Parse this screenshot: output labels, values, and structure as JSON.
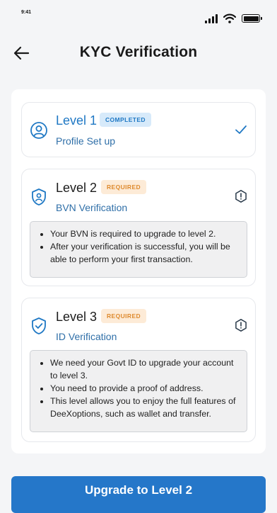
{
  "status_bar": {
    "time": "9:41"
  },
  "header": {
    "title": "KYC Verification"
  },
  "levels": [
    {
      "title": "Level 1",
      "badge": "COMPLETED",
      "subtitle": "Profile Set up",
      "status": "completed",
      "icon": "user-circle-icon",
      "status_icon": "check-icon"
    },
    {
      "title": "Level 2",
      "badge": "REQUIRED",
      "subtitle": "BVN Verification",
      "status": "required",
      "icon": "shield-user-icon",
      "status_icon": "info-alert-icon",
      "notes": [
        "Your BVN is required to upgrade to level 2.",
        "After your verification is successful, you will be able to perform your first transaction."
      ]
    },
    {
      "title": "Level 3",
      "badge": "REQUIRED",
      "subtitle": "ID Verification",
      "status": "required",
      "icon": "shield-check-icon",
      "status_icon": "info-alert-icon",
      "notes": [
        "We need your Govt ID to upgrade your account to level 3.",
        "You need to provide a proof of address.",
        "This level allows you to enjoy the full features of DeeXoptions, such as wallet and transfer."
      ]
    }
  ],
  "cta": {
    "label": "Upgrade to Level 2"
  },
  "colors": {
    "accent": "#2577c9",
    "completed_badge_bg": "#d7eafa",
    "required_badge_bg": "#fdebd7",
    "required_badge_text": "#de8a2e"
  }
}
